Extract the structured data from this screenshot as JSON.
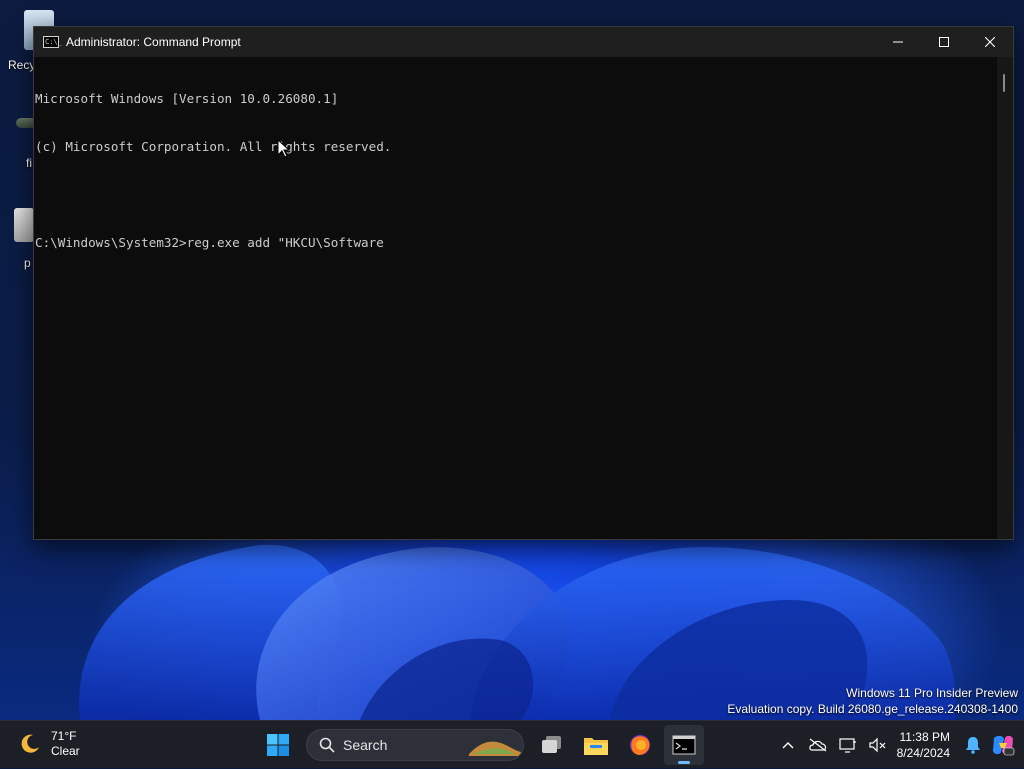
{
  "desktop": {
    "icons": [
      {
        "label": "Recy"
      },
      {
        "label": "fi"
      },
      {
        "label": "p"
      }
    ],
    "watermark": {
      "line1": "Windows 11 Pro Insider Preview",
      "line2": "Evaluation copy. Build 26080.ge_release.240308-1400"
    }
  },
  "window": {
    "title": "Administrator: Command Prompt",
    "icon_text": "C:\\_",
    "controls": {
      "minimize": "—",
      "maximize": "☐",
      "close": "✕"
    },
    "console_lines": [
      "Microsoft Windows [Version 10.0.26080.1]",
      "(c) Microsoft Corporation. All rights reserved.",
      "",
      "C:\\Windows\\System32>reg.exe add \"HKCU\\Software"
    ]
  },
  "taskbar": {
    "weather": {
      "temp": "71°F",
      "condition": "Clear",
      "icon": "moon-icon"
    },
    "search": {
      "label": "Search"
    },
    "apps": [
      "start-icon",
      "task-view-icon",
      "file-explorer-icon",
      "firefox-icon",
      "terminal-icon"
    ],
    "tray": {
      "chevron": "^",
      "clock_time": "11:38 PM",
      "clock_date": "8/24/2024"
    }
  },
  "colors": {
    "console_bg": "#0c0c0c",
    "console_text": "#cccccc",
    "titlebar": "#1f1f1f",
    "taskbar": "#1c1f26",
    "accent": "#6fb7ff"
  }
}
